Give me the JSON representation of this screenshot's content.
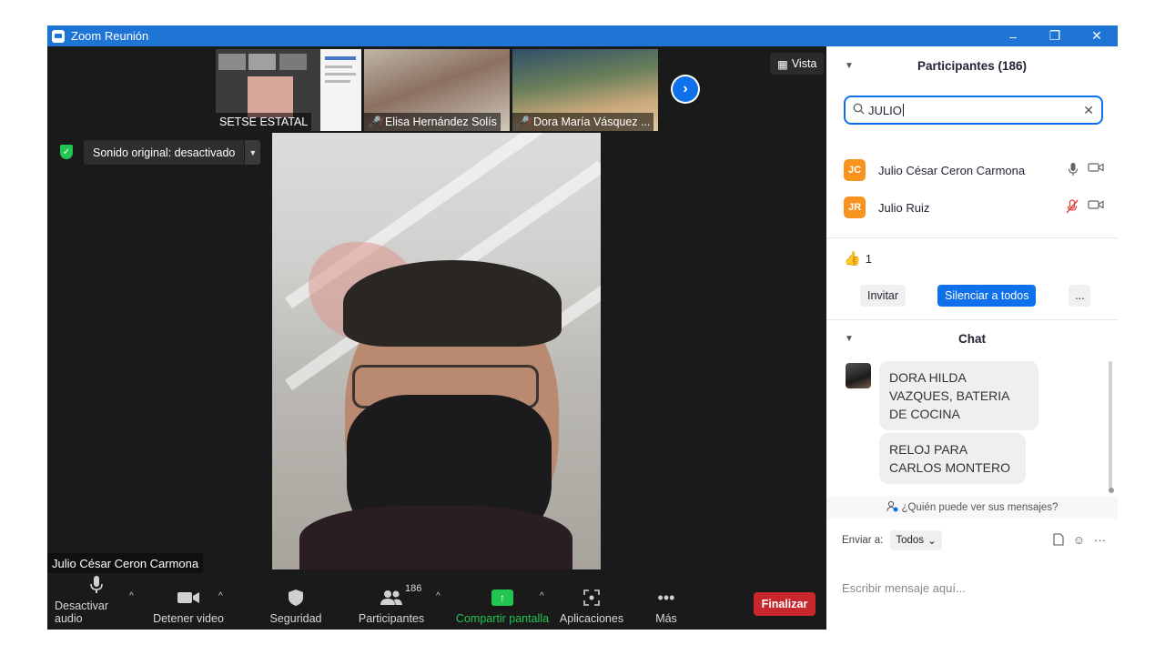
{
  "window": {
    "title": "Zoom Reunión",
    "minimize_label": "–",
    "restore_label": "❐",
    "close_label": "✕"
  },
  "meeting": {
    "thumbnails": [
      {
        "name": "SETSE ESTATAL",
        "muted": false
      },
      {
        "name": "Elisa Hernández Solís",
        "muted": true
      },
      {
        "name": "Dora María Vásquez ...",
        "muted": true
      }
    ],
    "view_label": "Vista",
    "sound_status": "Sonido original: desactivado",
    "active_speaker": "Julio César Ceron Carmona"
  },
  "toolbar": {
    "mute_audio": "Desactivar audio",
    "stop_video": "Detener video",
    "security": "Seguridad",
    "participants": "Participantes",
    "participant_count": "186",
    "share_screen": "Compartir pantalla",
    "apps": "Aplicaciones",
    "more": "Más",
    "end": "Finalizar"
  },
  "participants_panel": {
    "title": "Participantes (186)",
    "search_value": "JULIO",
    "people": [
      {
        "initials": "JC",
        "name": "Julio César Ceron Carmona",
        "mic_muted": false
      },
      {
        "initials": "JR",
        "name": "Julio Ruiz",
        "mic_muted": true
      }
    ],
    "reaction_count": "1",
    "invite_label": "Invitar",
    "mute_all_label": "Silenciar a todos",
    "more_label": "..."
  },
  "chat": {
    "title": "Chat",
    "messages": [
      "DORA HILDA VAZQUES, BATERIA DE COCINA",
      "RELOJ PARA CARLOS MONTERO"
    ],
    "who_can_see": "¿Quién puede ver sus mensajes?",
    "send_to_label": "Enviar a:",
    "send_to_value": "Todos",
    "input_placeholder": "Escribir mensaje aquí..."
  },
  "colors": {
    "accent": "#0e71eb",
    "end_red": "#c8282d",
    "share_green": "#23c552",
    "avatar_orange": "#f7931e"
  }
}
